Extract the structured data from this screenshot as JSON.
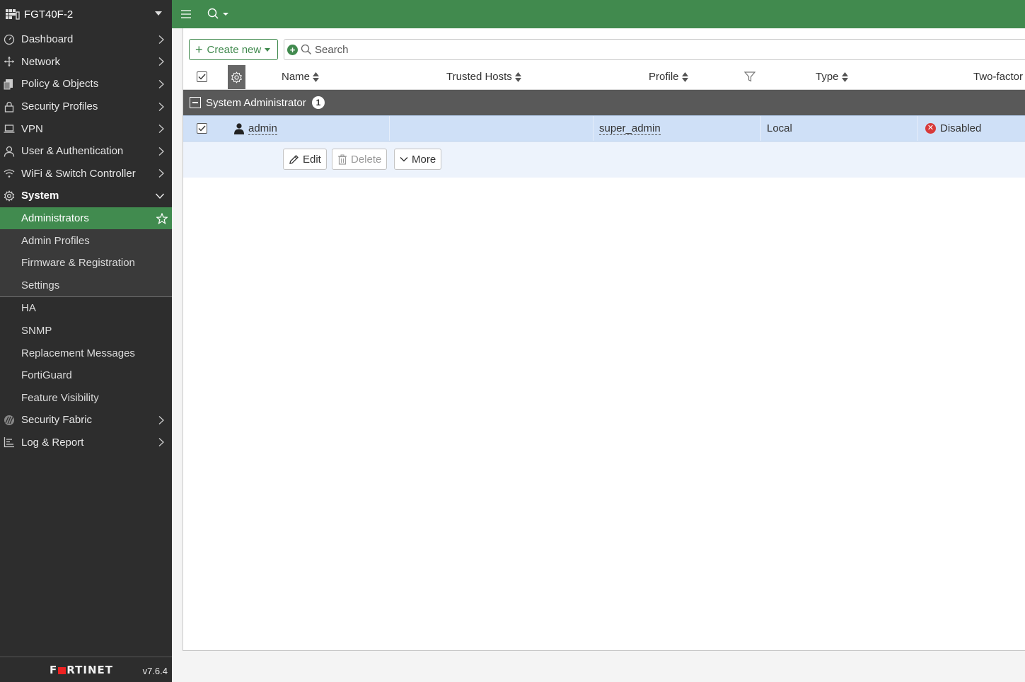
{
  "device": {
    "name": "FGT40F-2",
    "version": "v7.6.4",
    "logo_text": "F▒RTINET"
  },
  "sidebar": {
    "items": [
      {
        "label": "Dashboard",
        "icon": "dashboard-icon"
      },
      {
        "label": "Network",
        "icon": "network-icon"
      },
      {
        "label": "Policy & Objects",
        "icon": "policy-icon"
      },
      {
        "label": "Security Profiles",
        "icon": "lock-icon"
      },
      {
        "label": "VPN",
        "icon": "laptop-icon"
      },
      {
        "label": "User & Authentication",
        "icon": "user-icon"
      },
      {
        "label": "WiFi & Switch Controller",
        "icon": "wifi-icon"
      },
      {
        "label": "System",
        "icon": "gear-icon"
      }
    ],
    "system_sub": [
      {
        "label": "Administrators"
      },
      {
        "label": "Admin Profiles"
      },
      {
        "label": "Firmware & Registration"
      },
      {
        "label": "Settings"
      }
    ],
    "system_sub2": [
      {
        "label": "HA"
      },
      {
        "label": "SNMP"
      },
      {
        "label": "Replacement Messages"
      },
      {
        "label": "FortiGuard"
      },
      {
        "label": "Feature Visibility"
      }
    ],
    "items_after": [
      {
        "label": "Security Fabric",
        "icon": "fabric-icon"
      },
      {
        "label": "Log & Report",
        "icon": "chart-icon"
      }
    ]
  },
  "toolbar": {
    "create_label": "Create new",
    "search_placeholder": "Search"
  },
  "table": {
    "headers": {
      "name": "Name",
      "trusted_hosts": "Trusted Hosts",
      "profile": "Profile",
      "type": "Type",
      "two_factor": "Two-factor"
    },
    "group": {
      "label": "System Administrator",
      "count": "1"
    },
    "rows": [
      {
        "name": "admin",
        "trusted_hosts": "",
        "profile": "super_admin",
        "type": "Local",
        "two_factor": "Disabled"
      }
    ]
  },
  "actions": {
    "edit": "Edit",
    "delete": "Delete",
    "more": "More"
  },
  "colors": {
    "accent": "#418a4e",
    "sidebar_bg": "#2d2d2d",
    "selected_row": "#cfe0f7",
    "error": "#d83a3a"
  }
}
